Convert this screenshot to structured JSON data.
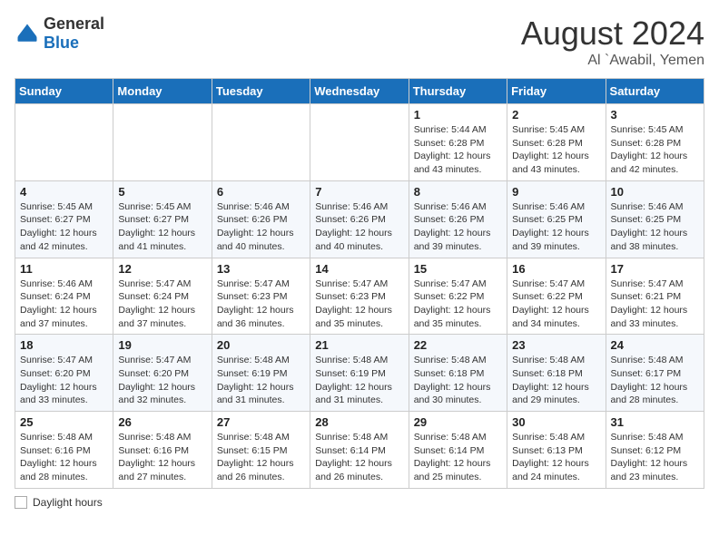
{
  "header": {
    "logo_general": "General",
    "logo_blue": "Blue",
    "month_title": "August 2024",
    "location": "Al `Awabil, Yemen"
  },
  "weekdays": [
    "Sunday",
    "Monday",
    "Tuesday",
    "Wednesday",
    "Thursday",
    "Friday",
    "Saturday"
  ],
  "weeks": [
    [
      {
        "day": "",
        "info": ""
      },
      {
        "day": "",
        "info": ""
      },
      {
        "day": "",
        "info": ""
      },
      {
        "day": "",
        "info": ""
      },
      {
        "day": "1",
        "info": "Sunrise: 5:44 AM\nSunset: 6:28 PM\nDaylight: 12 hours and 43 minutes."
      },
      {
        "day": "2",
        "info": "Sunrise: 5:45 AM\nSunset: 6:28 PM\nDaylight: 12 hours and 43 minutes."
      },
      {
        "day": "3",
        "info": "Sunrise: 5:45 AM\nSunset: 6:28 PM\nDaylight: 12 hours and 42 minutes."
      }
    ],
    [
      {
        "day": "4",
        "info": "Sunrise: 5:45 AM\nSunset: 6:27 PM\nDaylight: 12 hours and 42 minutes."
      },
      {
        "day": "5",
        "info": "Sunrise: 5:45 AM\nSunset: 6:27 PM\nDaylight: 12 hours and 41 minutes."
      },
      {
        "day": "6",
        "info": "Sunrise: 5:46 AM\nSunset: 6:26 PM\nDaylight: 12 hours and 40 minutes."
      },
      {
        "day": "7",
        "info": "Sunrise: 5:46 AM\nSunset: 6:26 PM\nDaylight: 12 hours and 40 minutes."
      },
      {
        "day": "8",
        "info": "Sunrise: 5:46 AM\nSunset: 6:26 PM\nDaylight: 12 hours and 39 minutes."
      },
      {
        "day": "9",
        "info": "Sunrise: 5:46 AM\nSunset: 6:25 PM\nDaylight: 12 hours and 39 minutes."
      },
      {
        "day": "10",
        "info": "Sunrise: 5:46 AM\nSunset: 6:25 PM\nDaylight: 12 hours and 38 minutes."
      }
    ],
    [
      {
        "day": "11",
        "info": "Sunrise: 5:46 AM\nSunset: 6:24 PM\nDaylight: 12 hours and 37 minutes."
      },
      {
        "day": "12",
        "info": "Sunrise: 5:47 AM\nSunset: 6:24 PM\nDaylight: 12 hours and 37 minutes."
      },
      {
        "day": "13",
        "info": "Sunrise: 5:47 AM\nSunset: 6:23 PM\nDaylight: 12 hours and 36 minutes."
      },
      {
        "day": "14",
        "info": "Sunrise: 5:47 AM\nSunset: 6:23 PM\nDaylight: 12 hours and 35 minutes."
      },
      {
        "day": "15",
        "info": "Sunrise: 5:47 AM\nSunset: 6:22 PM\nDaylight: 12 hours and 35 minutes."
      },
      {
        "day": "16",
        "info": "Sunrise: 5:47 AM\nSunset: 6:22 PM\nDaylight: 12 hours and 34 minutes."
      },
      {
        "day": "17",
        "info": "Sunrise: 5:47 AM\nSunset: 6:21 PM\nDaylight: 12 hours and 33 minutes."
      }
    ],
    [
      {
        "day": "18",
        "info": "Sunrise: 5:47 AM\nSunset: 6:20 PM\nDaylight: 12 hours and 33 minutes."
      },
      {
        "day": "19",
        "info": "Sunrise: 5:47 AM\nSunset: 6:20 PM\nDaylight: 12 hours and 32 minutes."
      },
      {
        "day": "20",
        "info": "Sunrise: 5:48 AM\nSunset: 6:19 PM\nDaylight: 12 hours and 31 minutes."
      },
      {
        "day": "21",
        "info": "Sunrise: 5:48 AM\nSunset: 6:19 PM\nDaylight: 12 hours and 31 minutes."
      },
      {
        "day": "22",
        "info": "Sunrise: 5:48 AM\nSunset: 6:18 PM\nDaylight: 12 hours and 30 minutes."
      },
      {
        "day": "23",
        "info": "Sunrise: 5:48 AM\nSunset: 6:18 PM\nDaylight: 12 hours and 29 minutes."
      },
      {
        "day": "24",
        "info": "Sunrise: 5:48 AM\nSunset: 6:17 PM\nDaylight: 12 hours and 28 minutes."
      }
    ],
    [
      {
        "day": "25",
        "info": "Sunrise: 5:48 AM\nSunset: 6:16 PM\nDaylight: 12 hours and 28 minutes."
      },
      {
        "day": "26",
        "info": "Sunrise: 5:48 AM\nSunset: 6:16 PM\nDaylight: 12 hours and 27 minutes."
      },
      {
        "day": "27",
        "info": "Sunrise: 5:48 AM\nSunset: 6:15 PM\nDaylight: 12 hours and 26 minutes."
      },
      {
        "day": "28",
        "info": "Sunrise: 5:48 AM\nSunset: 6:14 PM\nDaylight: 12 hours and 26 minutes."
      },
      {
        "day": "29",
        "info": "Sunrise: 5:48 AM\nSunset: 6:14 PM\nDaylight: 12 hours and 25 minutes."
      },
      {
        "day": "30",
        "info": "Sunrise: 5:48 AM\nSunset: 6:13 PM\nDaylight: 12 hours and 24 minutes."
      },
      {
        "day": "31",
        "info": "Sunrise: 5:48 AM\nSunset: 6:12 PM\nDaylight: 12 hours and 23 minutes."
      }
    ]
  ],
  "footer": {
    "daylight_label": "Daylight hours"
  }
}
